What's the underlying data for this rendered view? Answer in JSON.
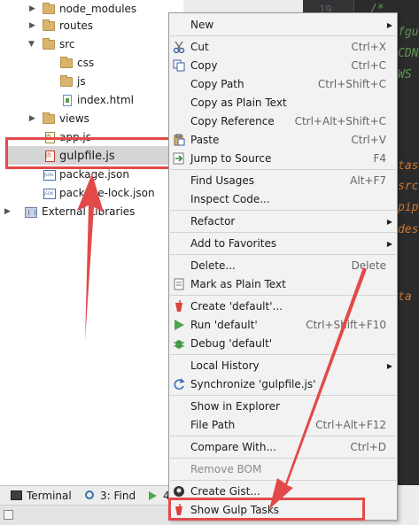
{
  "project_tree": {
    "items": [
      {
        "label": "node_modules",
        "icon": "folder-icon",
        "expanded": false
      },
      {
        "label": "routes",
        "icon": "folder-icon",
        "expanded": false
      },
      {
        "label": "src",
        "icon": "folder-icon",
        "expanded": true
      },
      {
        "label": "css",
        "icon": "folder-icon",
        "expanded": false
      },
      {
        "label": "js",
        "icon": "folder-icon",
        "expanded": false
      },
      {
        "label": "index.html",
        "icon": "html-file-icon"
      },
      {
        "label": "views",
        "icon": "folder-icon",
        "expanded": false
      },
      {
        "label": "app.js",
        "icon": "js-file-icon"
      },
      {
        "label": "gulpfile.js",
        "icon": "gulp-file-icon",
        "selected": true
      },
      {
        "label": "package.json",
        "icon": "json-file-icon"
      },
      {
        "label": "package-lock.json",
        "icon": "json-file-icon"
      },
      {
        "label": "External Libraries",
        "icon": "libraries-icon"
      }
    ]
  },
  "editor": {
    "line_number": "19",
    "lines": [
      "/*",
      "fgu",
      "CDN",
      "WS",
      "tas",
      "src",
      "pip",
      "des",
      "ta"
    ],
    "colors": {
      "comment": "#629755",
      "keyword": "#cc7832"
    }
  },
  "context_menu": {
    "items": [
      {
        "label": "New",
        "shortcut": "",
        "submenu": true,
        "icon": ""
      },
      {
        "label": "Cut",
        "shortcut": "Ctrl+X",
        "icon": "scissors-icon"
      },
      {
        "label": "Copy",
        "shortcut": "Ctrl+C",
        "icon": "copy-icon"
      },
      {
        "label": "Copy Path",
        "shortcut": "Ctrl+Shift+C",
        "icon": ""
      },
      {
        "label": "Copy as Plain Text",
        "shortcut": "",
        "icon": ""
      },
      {
        "label": "Copy Reference",
        "shortcut": "Ctrl+Alt+Shift+C",
        "icon": ""
      },
      {
        "label": "Paste",
        "shortcut": "Ctrl+V",
        "icon": "paste-icon"
      },
      {
        "label": "Jump to Source",
        "shortcut": "F4",
        "icon": "jump-to-source-icon"
      },
      {
        "label": "Find Usages",
        "shortcut": "Alt+F7",
        "icon": ""
      },
      {
        "label": "Inspect Code...",
        "shortcut": "",
        "icon": ""
      },
      {
        "label": "Refactor",
        "shortcut": "",
        "submenu": true,
        "icon": ""
      },
      {
        "label": "Add to Favorites",
        "shortcut": "",
        "submenu": true,
        "icon": ""
      },
      {
        "label": "Delete...",
        "shortcut": "Delete",
        "icon": ""
      },
      {
        "label": "Mark as Plain Text",
        "shortcut": "",
        "icon": "plain-text-icon"
      },
      {
        "label": "Create 'default'...",
        "shortcut": "",
        "icon": "gulp-icon"
      },
      {
        "label": "Run 'default'",
        "shortcut": "Ctrl+Shift+F10",
        "icon": "run-icon"
      },
      {
        "label": "Debug 'default'",
        "shortcut": "",
        "icon": "debug-icon"
      },
      {
        "label": "Local History",
        "shortcut": "",
        "submenu": true,
        "icon": ""
      },
      {
        "label": "Synchronize 'gulpfile.js'",
        "shortcut": "",
        "icon": "sync-icon"
      },
      {
        "label": "Show in Explorer",
        "shortcut": "",
        "icon": ""
      },
      {
        "label": "File Path",
        "shortcut": "Ctrl+Alt+F12",
        "icon": ""
      },
      {
        "label": "Compare With...",
        "shortcut": "Ctrl+D",
        "icon": "compare-icon"
      },
      {
        "label": "Remove BOM",
        "shortcut": "",
        "disabled": true,
        "icon": ""
      },
      {
        "label": "Create Gist...",
        "shortcut": "",
        "icon": "github-icon"
      },
      {
        "label": "Show Gulp Tasks",
        "shortcut": "",
        "icon": "gulp-icon"
      }
    ]
  },
  "bottom_bar": {
    "terminal_label": "Terminal",
    "find_label": "3: Find",
    "run_label": "4"
  },
  "colors": {
    "annotation_red": "#e24a4a",
    "selection": "#d5d5d5",
    "menu_bg": "#f2f2f2"
  }
}
